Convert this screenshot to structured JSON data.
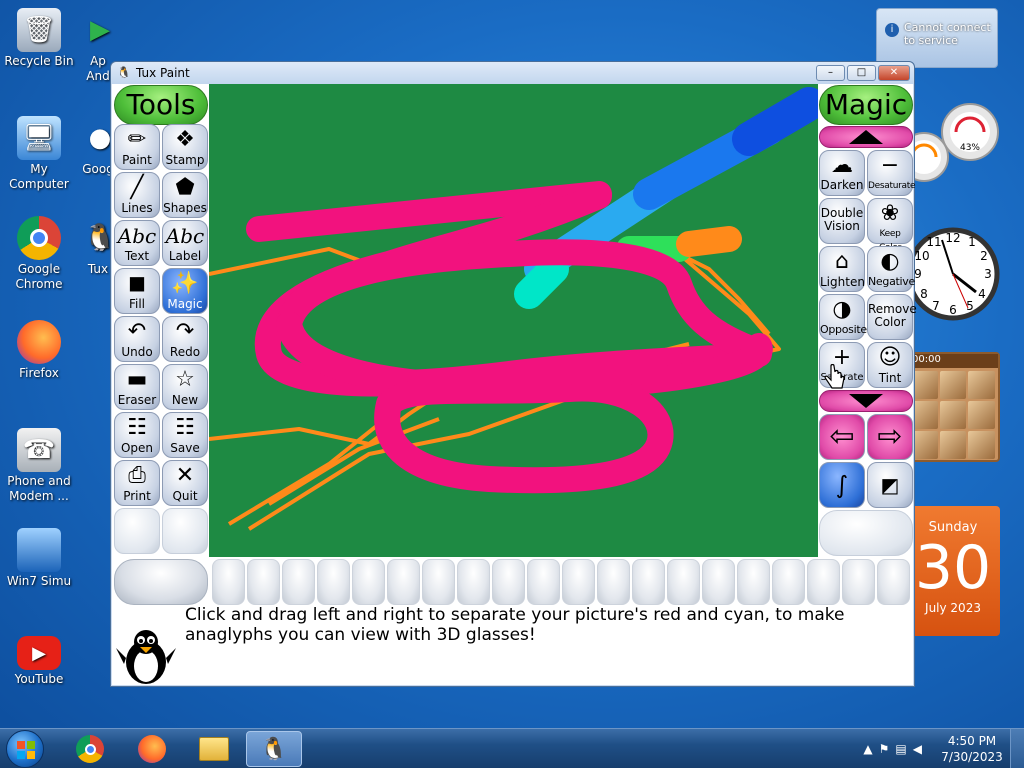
{
  "desktop": {
    "icons": [
      {
        "name": "recycle-bin",
        "label": "Recycle Bin"
      },
      {
        "name": "apps",
        "label": "Ap\nAnd"
      },
      {
        "name": "my-computer",
        "label": "My Computer"
      },
      {
        "name": "google-2",
        "label": "Goog"
      },
      {
        "name": "google-chrome",
        "label": "Google Chrome"
      },
      {
        "name": "tux",
        "label": "Tux"
      },
      {
        "name": "firefox",
        "label": "Firefox"
      },
      {
        "name": "phone-modem",
        "label": "Phone and Modem ..."
      },
      {
        "name": "win7-simu",
        "label": "Win7 Simu"
      },
      {
        "name": "youtube",
        "label": "YouTube"
      }
    ],
    "notification": "Cannot connect to service",
    "meter_percent": "43%",
    "puzzle_time": "00:00",
    "calendar": {
      "day": "Sunday",
      "date": "30",
      "month": "July 2023"
    }
  },
  "window": {
    "title": "Tux Paint",
    "controls": {
      "minimize": "–",
      "maximize": "□",
      "close": "✕"
    }
  },
  "tools": {
    "header": "Tools",
    "items": [
      {
        "label": "Paint",
        "icon": "✏"
      },
      {
        "label": "Stamp",
        "icon": "❖"
      },
      {
        "label": "Lines",
        "icon": "╱"
      },
      {
        "label": "Shapes",
        "icon": "⬟"
      },
      {
        "label": "Text",
        "icon": "Abc"
      },
      {
        "label": "Label",
        "icon": "Abc"
      },
      {
        "label": "Fill",
        "icon": "◼"
      },
      {
        "label": "Magic",
        "icon": "✨"
      },
      {
        "label": "Undo",
        "icon": "↶"
      },
      {
        "label": "Redo",
        "icon": "↷"
      },
      {
        "label": "Eraser",
        "icon": "▬"
      },
      {
        "label": "New",
        "icon": "☆"
      },
      {
        "label": "Open",
        "icon": "☷"
      },
      {
        "label": "Save",
        "icon": "☷"
      },
      {
        "label": "Print",
        "icon": "⎙"
      },
      {
        "label": "Quit",
        "icon": "✕"
      }
    ]
  },
  "magic": {
    "header": "Magic",
    "items": [
      {
        "label": "Darken",
        "icon": "☁"
      },
      {
        "label": "Desaturate",
        "icon": "−"
      },
      {
        "label": "Double Vision",
        "icon": "◎"
      },
      {
        "label": "Keep Color",
        "icon": "❀"
      },
      {
        "label": "Lighten",
        "icon": "⌂"
      },
      {
        "label": "Negative",
        "icon": "◐"
      },
      {
        "label": "Opposite",
        "icon": "◑"
      },
      {
        "label": "Remove Color",
        "icon": "☁"
      },
      {
        "label": "Saturate",
        "icon": "+"
      },
      {
        "label": "Tint",
        "icon": "☺"
      }
    ]
  },
  "status": {
    "message": "Click and drag left and right to separate your picture's red and cyan, to make anaglyphs you can view with 3D glasses!"
  },
  "taskbar": {
    "time": "4:50 PM",
    "date": "7/30/2023"
  },
  "colors": {
    "canvas_bg": "#1e8a43",
    "pink_stroke": "#f2127e",
    "orange_line": "#ff8a1a",
    "blue_stroke": "#1e6fe8"
  }
}
